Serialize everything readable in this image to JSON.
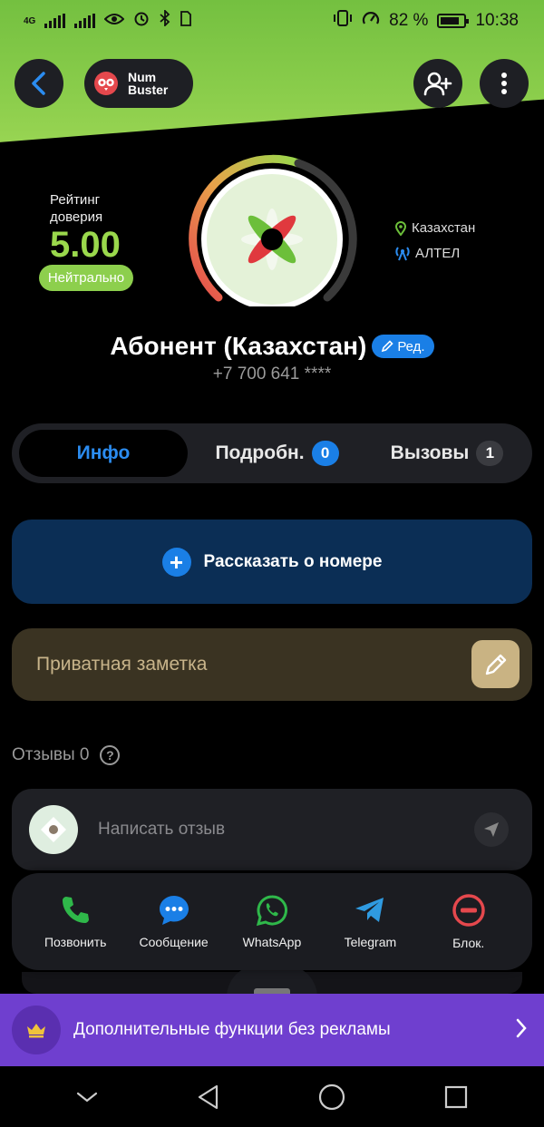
{
  "status_bar": {
    "network_type": "4G",
    "battery_percent": "82 %",
    "battery_level": 0.82,
    "time": "10:38"
  },
  "header": {
    "brand_line1": "Num",
    "brand_line2": "Buster",
    "icons": [
      "back-arrow-icon",
      "add-user-icon",
      "more-vertical-icon"
    ]
  },
  "rating": {
    "label": "Рейтинг доверия",
    "value": "5.00",
    "badge": "Нейтрально"
  },
  "location": {
    "country": "Казахстан",
    "operator": "АЛТЕЛ"
  },
  "contact": {
    "name": "Абонент (Казахстан)",
    "edit_label": "Ред.",
    "phone": "+7 700 641 ****"
  },
  "tabs": [
    {
      "label": "Инфо"
    },
    {
      "label": "Подробн.",
      "count": "0"
    },
    {
      "label": "Вызовы",
      "count": "1"
    }
  ],
  "tell_button": "Рассказать о номере",
  "private_note": "Приватная заметка",
  "reviews": {
    "title": "Отзывы 0",
    "placeholder": "Написать отзыв"
  },
  "actions": [
    {
      "label": "Позвонить",
      "icon": "phone-icon",
      "color": "#2fb84a"
    },
    {
      "label": "Сообщение",
      "icon": "chat-bubble-icon",
      "color": "#1a7fe6"
    },
    {
      "label": "WhatsApp",
      "icon": "whatsapp-icon",
      "color": "#2fb84a"
    },
    {
      "label": "Telegram",
      "icon": "telegram-icon",
      "color": "#2f9ae0"
    },
    {
      "label": "Блок.",
      "icon": "block-icon",
      "color": "#e5484d"
    }
  ],
  "promo": {
    "text": "Дополнительные функции без рекламы"
  },
  "colors": {
    "accent_green": "#9ad84c",
    "accent_blue": "#1a7fe6",
    "promo_purple": "#6f3fcf"
  }
}
